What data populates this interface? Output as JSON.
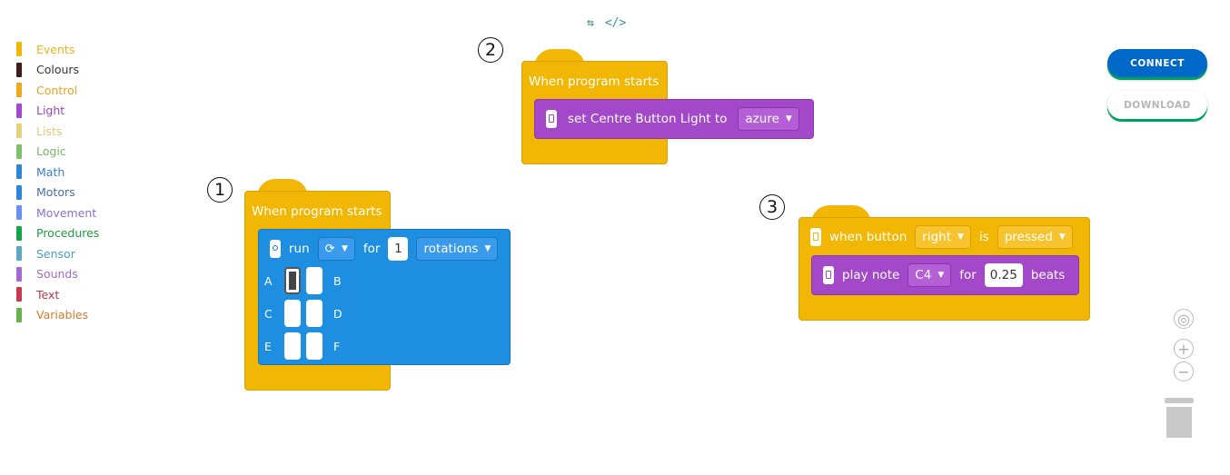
{
  "categories": [
    {
      "label": "Events",
      "color": "#f2b705",
      "text_color": "#e8b21a"
    },
    {
      "label": "Colours",
      "color": "#3a1e1e",
      "text_color": "#333333"
    },
    {
      "label": "Control",
      "color": "#f2a81d",
      "text_color": "#f0a020"
    },
    {
      "label": "Light",
      "color": "#a348c9",
      "text_color": "#9b45c4"
    },
    {
      "label": "Lists",
      "color": "#e8d07a",
      "text_color": "#e3c974"
    },
    {
      "label": "Logic",
      "color": "#7fbf6a",
      "text_color": "#7ab866"
    },
    {
      "label": "Math",
      "color": "#2f86d8",
      "text_color": "#3a7fc9"
    },
    {
      "label": "Motors",
      "color": "#2f86d8",
      "text_color": "#4a6fa5"
    },
    {
      "label": "Movement",
      "color": "#6a8ff0",
      "text_color": "#8a6fd0"
    },
    {
      "label": "Procedures",
      "color": "#16a34a",
      "text_color": "#1f9a3f"
    },
    {
      "label": "Sensor",
      "color": "#5aa7c8",
      "text_color": "#4f9cc0"
    },
    {
      "label": "Sounds",
      "color": "#a36ad0",
      "text_color": "#a06acc"
    },
    {
      "label": "Text",
      "color": "#c83a4f",
      "text_color": "#b8384c"
    },
    {
      "label": "Variables",
      "color": "#6ab04c",
      "text_color": "#d07a30"
    }
  ],
  "top_icons": {
    "blocks_view": "⇆",
    "code_view": "</>"
  },
  "steps": {
    "one": "1",
    "two": "2",
    "three": "3"
  },
  "stack1": {
    "hat": "When program starts",
    "run": "run",
    "direction": "⟳",
    "for": "for",
    "amount": "1",
    "unit": "rotations",
    "ports": [
      [
        "A",
        "B"
      ],
      [
        "C",
        "D"
      ],
      [
        "E",
        "F"
      ]
    ]
  },
  "stack2": {
    "hat": "When program starts",
    "set_label": "set Centre Button Light to",
    "color_value": "azure"
  },
  "stack3": {
    "when_button": "when button",
    "button": "right",
    "is": "is",
    "state": "pressed",
    "play_note": "play note",
    "note": "C4",
    "for": "for",
    "beats_value": "0.25",
    "beats": "beats"
  },
  "buttons": {
    "connect": "CONNECT",
    "download": "DOWNLOAD"
  }
}
